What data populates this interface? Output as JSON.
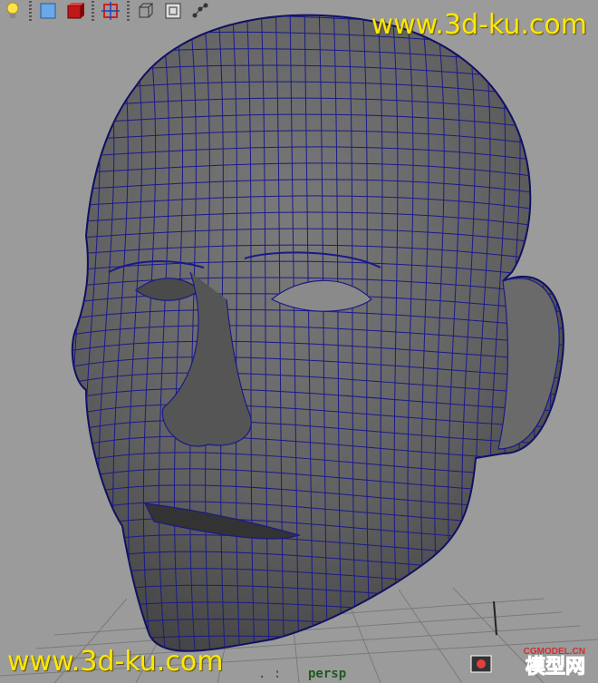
{
  "toolbar": {
    "buttons": [
      {
        "icon": "light-bulb-icon",
        "label": "Lights"
      },
      {
        "icon": "blue-cube-icon",
        "label": "Smooth shade"
      },
      {
        "icon": "red-cube-icon",
        "label": "Textured"
      },
      {
        "icon": "frame-select-icon",
        "label": "Frame"
      },
      {
        "icon": "wireframe-cube-icon",
        "label": "Wireframe"
      },
      {
        "icon": "isolate-icon",
        "label": "Isolate"
      },
      {
        "icon": "camera-path-icon",
        "label": "Camera"
      }
    ]
  },
  "watermark": {
    "top": "www.3d-ku.com",
    "bottom": "www.3d-ku.com"
  },
  "viewport": {
    "camera_dots": ". :",
    "camera_name": "persp"
  },
  "logo": {
    "small": "CGMODEL.CN",
    "big": "模型网"
  },
  "colors": {
    "background": "#9b9b9b",
    "mesh_fill": "#5c5c5c",
    "wire": "#1a1a8a",
    "watermark": "#ffe800"
  }
}
